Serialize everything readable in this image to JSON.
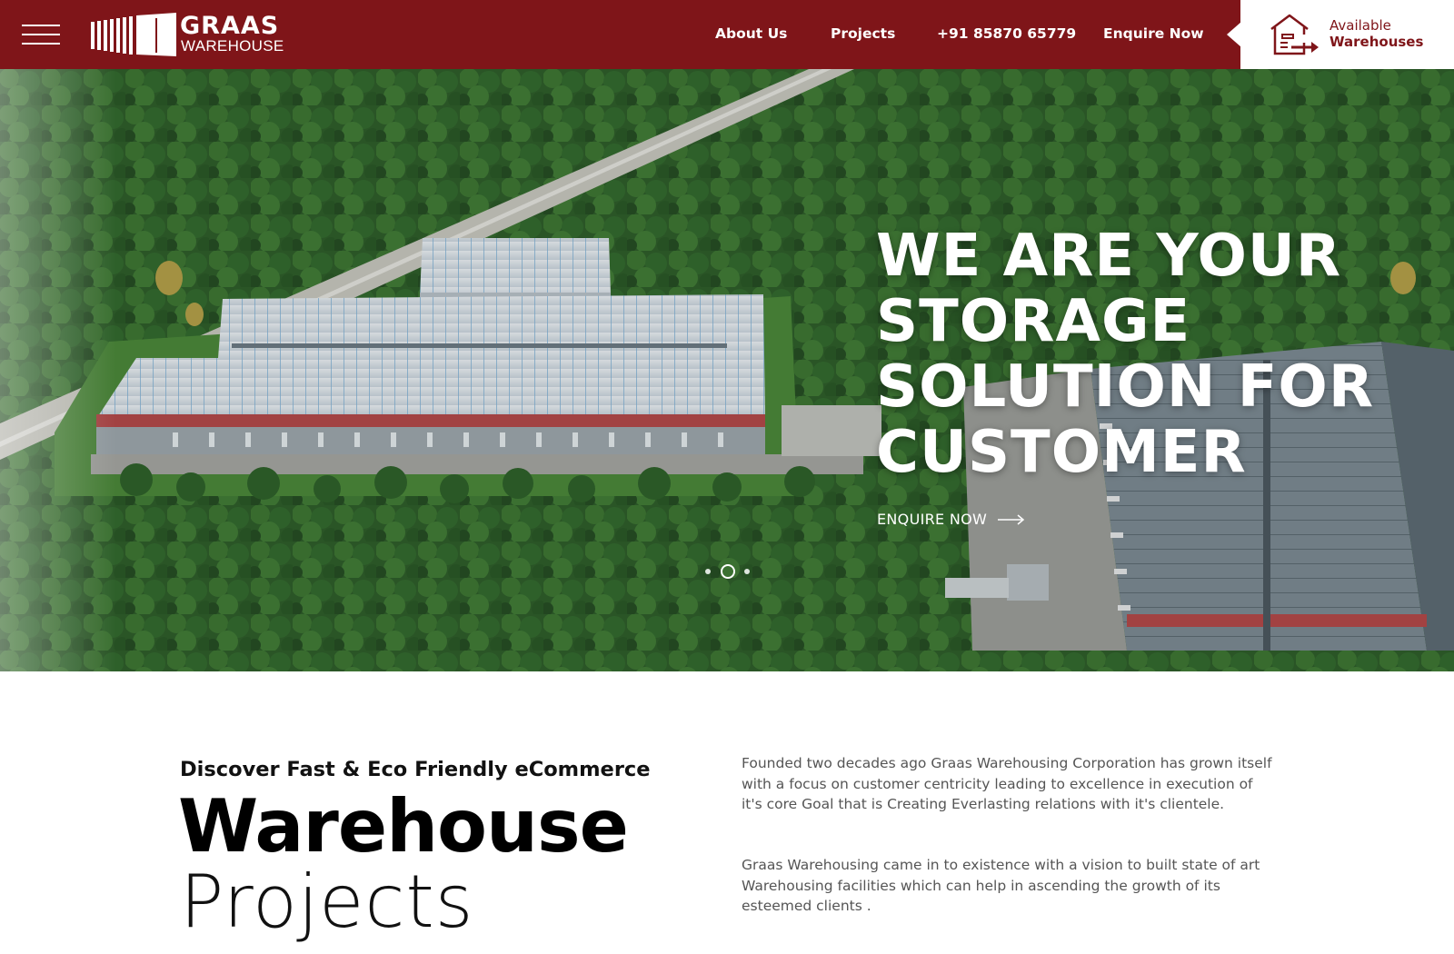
{
  "brand": {
    "name": "GRAAS",
    "subtitle": "WAREHOUSE"
  },
  "nav": {
    "menu_icon": "hamburger-menu-icon",
    "items": [
      {
        "label": "About Us"
      },
      {
        "label": "Projects"
      },
      {
        "label": "+91 85870 65779"
      },
      {
        "label": "Enquire Now"
      }
    ],
    "available": {
      "line1": "Available",
      "line2": "Warehouses",
      "icon": "warehouse-arrow-icon"
    }
  },
  "hero": {
    "title_lines": [
      "WE ARE YOUR",
      "STORAGE",
      "SOLUTION FOR",
      "CUSTOMER"
    ],
    "cta_label": "ENQUIRE NOW",
    "cta_icon": "arrow-right-icon",
    "slides_total": 3,
    "active_slide": 2
  },
  "about": {
    "eyebrow": "Discover Fast & Eco Friendly eCommerce",
    "title": "Warehouse",
    "subtitle": "Projects",
    "paragraphs": [
      "Founded two decades ago Graas Warehousing Corporation has grown itself with a focus on customer centricity leading to excellence in execution of it's core Goal that is Creating Everlasting relations with it's clientele.",
      "Graas Warehousing came in to existence with a vision to built state of art Warehousing facilities which can help in ascending the growth of its esteemed clients ."
    ]
  },
  "colors": {
    "brand_red": "#7f1519",
    "white": "#ffffff",
    "text_dark": "#000000",
    "text_muted": "#555555"
  }
}
